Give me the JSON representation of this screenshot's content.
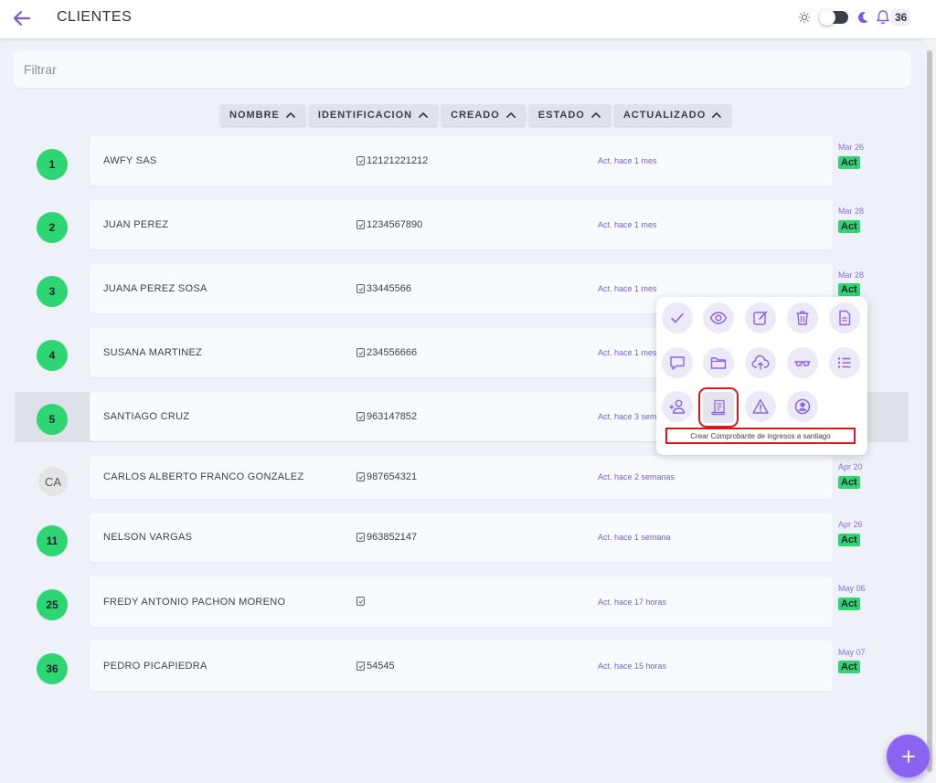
{
  "header": {
    "title": "CLIENTES",
    "notification_count": "36"
  },
  "filter": {
    "placeholder": "Filtrar",
    "value": ""
  },
  "sort_columns": [
    "NOMBRE",
    "IDENTIFICACION",
    "CREADO",
    "ESTADO",
    "ACTUALIZADO"
  ],
  "clients": [
    {
      "avatar": "1",
      "name": "AWFY SAS",
      "id": "12121221212",
      "updated": "Act. hace 1 mes",
      "date": "Mar 26",
      "status": "Act"
    },
    {
      "avatar": "2",
      "name": "JUAN PEREZ",
      "id": "1234567890",
      "updated": "Act. hace 1 mes",
      "date": "Mar 28",
      "status": "Act"
    },
    {
      "avatar": "3",
      "name": "JUANA PEREZ SOSA",
      "id": "33445566",
      "updated": "Act. hace 1 mes",
      "date": "Mar 28",
      "status": "Act"
    },
    {
      "avatar": "4",
      "name": "SUSANA MARTINEZ",
      "id": "234556666",
      "updated": "Act. hace 1 mes",
      "date": "",
      "status": ""
    },
    {
      "avatar": "5",
      "name": "SANTIAGO CRUZ",
      "id": "963147852",
      "updated": "Act. hace 3 sem",
      "date": "",
      "status": ""
    },
    {
      "avatar": "CA",
      "name": "CARLOS ALBERTO FRANCO GONZALEZ",
      "id": "987654321",
      "updated": "Act. hace 2 semanas",
      "date": "Apr 20",
      "status": "Act"
    },
    {
      "avatar": "11",
      "name": "NELSON VARGAS",
      "id": "963852147",
      "updated": "Act. hace 1 semana",
      "date": "Apr 26",
      "status": "Act"
    },
    {
      "avatar": "25",
      "name": "FREDY ANTONIO PACHON MORENO",
      "id": "",
      "updated": "Act. hace 17 horas",
      "date": "May 06",
      "status": "Act"
    },
    {
      "avatar": "36",
      "name": "PEDRO PICAPIEDRA",
      "id": "54545",
      "updated": "Act. hace 15 horas",
      "date": "May 07",
      "status": "Act"
    }
  ],
  "actions_menu": {
    "icons": [
      "check-icon",
      "eye-icon",
      "edit-icon",
      "trash-icon",
      "document-icon",
      "comment-icon",
      "folder-icon",
      "cloud-upload-icon",
      "glasses-icon",
      "list-icon",
      "add-user-icon",
      "receipt-icon",
      "warning-icon",
      "user-circle-icon"
    ],
    "tooltip": "Crear Comprobante de ingresos a santiago"
  },
  "colors": {
    "accent": "#8a63f0",
    "status_green": "#2ed573",
    "highlight_red": "#e0161a"
  }
}
